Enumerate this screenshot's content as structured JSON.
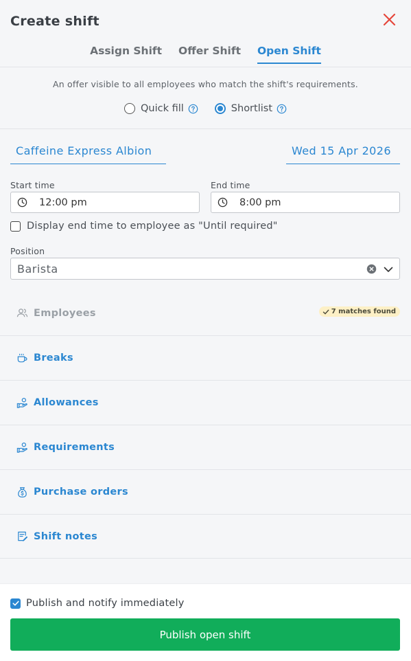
{
  "header": {
    "title": "Create shift",
    "tabs": [
      {
        "label": "Assign Shift",
        "active": false
      },
      {
        "label": "Offer Shift",
        "active": false
      },
      {
        "label": "Open Shift",
        "active": true
      }
    ]
  },
  "description": "An offer visible to all employees who match the shift's requirements.",
  "fill_mode": {
    "options": [
      {
        "label": "Quick fill",
        "selected": false
      },
      {
        "label": "Shortlist",
        "selected": true
      }
    ]
  },
  "location": "Caffeine Express Albion",
  "date": "Wed 15 Apr 2026",
  "start_time": {
    "label": "Start time",
    "value": "12:00 pm"
  },
  "end_time": {
    "label": "End time",
    "value": "8:00 pm"
  },
  "until_required": {
    "label": "Display end time to employee as \"Until required\"",
    "checked": false
  },
  "position": {
    "label": "Position",
    "value": "Barista"
  },
  "sections": [
    {
      "label": "Employees",
      "icon": "users-icon",
      "disabled": true,
      "badge": "7 matches found"
    },
    {
      "label": "Breaks",
      "icon": "coffee-cup-icon"
    },
    {
      "label": "Allowances",
      "icon": "hand-coins-icon"
    },
    {
      "label": "Requirements",
      "icon": "hand-coins-icon"
    },
    {
      "label": "Purchase orders",
      "icon": "money-bag-icon"
    },
    {
      "label": "Shift notes",
      "icon": "notes-icon"
    }
  ],
  "footer": {
    "publish_notify_label": "Publish and notify immediately",
    "publish_notify_checked": true,
    "publish_button": "Publish open shift"
  },
  "colors": {
    "accent": "#2b87d1",
    "close": "#e5473c",
    "publish": "#11ad5a",
    "badge_bg": "#fdf0c6"
  }
}
